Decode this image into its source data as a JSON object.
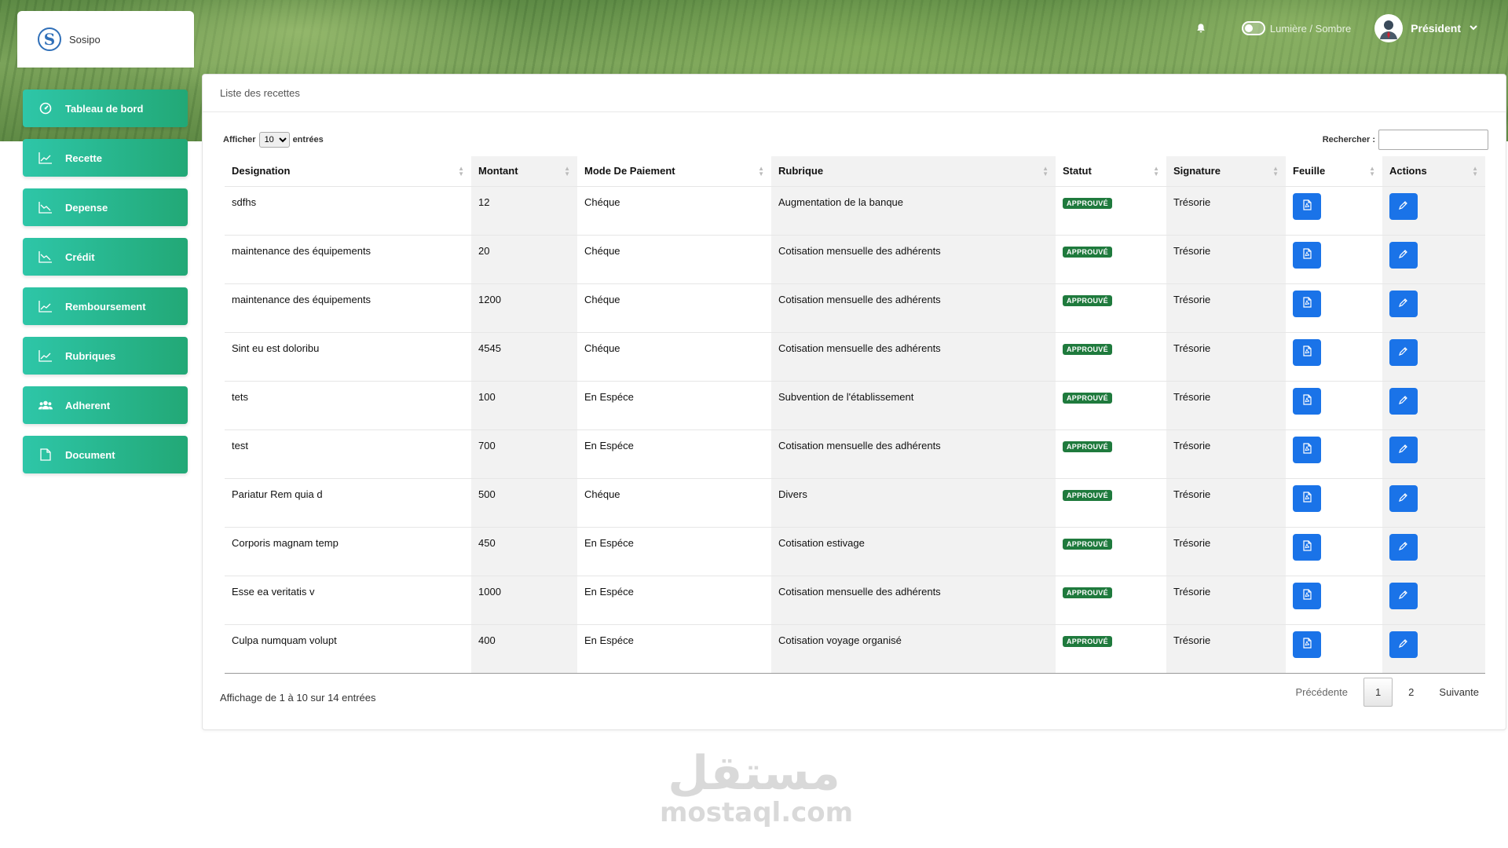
{
  "app": {
    "brand": "Sosipo",
    "logo_letter": "S"
  },
  "topbar": {
    "theme_toggle_label": "Lumière / Sombre",
    "user_name": "Président",
    "icons": [
      "bell-icon",
      "avatar",
      "chevron-down-icon"
    ]
  },
  "sidebar": {
    "items": [
      {
        "label": "Tableau de bord",
        "icon": "dashboard-icon"
      },
      {
        "label": "Recette",
        "icon": "chart-up-icon"
      },
      {
        "label": "Depense",
        "icon": "chart-down-icon"
      },
      {
        "label": "Crédit",
        "icon": "chart-down-icon"
      },
      {
        "label": "Remboursement",
        "icon": "chart-up-icon"
      },
      {
        "label": "Rubriques",
        "icon": "chart-up-icon"
      },
      {
        "label": "Adherent",
        "icon": "users-icon"
      },
      {
        "label": "Document",
        "icon": "document-icon"
      }
    ]
  },
  "card": {
    "title": "Liste des recettes",
    "length_prefix": "Afficher",
    "length_value": "10",
    "length_suffix": "entrées",
    "search_label": "Rechercher :",
    "search_value": ""
  },
  "table": {
    "columns": [
      "Designation",
      "Montant",
      "Mode De Paiement",
      "Rubrique",
      "Statut",
      "Signature",
      "Feuille",
      "Actions"
    ],
    "rows": [
      {
        "designation": "sdfhs",
        "montant": "12",
        "mode": "Chéque",
        "rubrique": "Augmentation de la banque",
        "statut": "APPROUVÉ",
        "signature": "Trésorie"
      },
      {
        "designation": "maintenance des équipements",
        "montant": "20",
        "mode": "Chéque",
        "rubrique": "Cotisation mensuelle des adhérents",
        "statut": "APPROUVÉ",
        "signature": "Trésorie"
      },
      {
        "designation": "maintenance des équipements",
        "montant": "1200",
        "mode": "Chéque",
        "rubrique": "Cotisation mensuelle des adhérents",
        "statut": "APPROUVÉ",
        "signature": "Trésorie"
      },
      {
        "designation": "Sint eu est doloribu",
        "montant": "4545",
        "mode": "Chéque",
        "rubrique": "Cotisation mensuelle des adhérents",
        "statut": "APPROUVÉ",
        "signature": "Trésorie"
      },
      {
        "designation": "tets",
        "montant": "100",
        "mode": "En Espéce",
        "rubrique": "Subvention de l'établissement",
        "statut": "APPROUVÉ",
        "signature": "Trésorie"
      },
      {
        "designation": "test",
        "montant": "700",
        "mode": "En Espéce",
        "rubrique": "Cotisation mensuelle des adhérents",
        "statut": "APPROUVÉ",
        "signature": "Trésorie"
      },
      {
        "designation": "Pariatur Rem quia d",
        "montant": "500",
        "mode": "Chéque",
        "rubrique": "Divers",
        "statut": "APPROUVÉ",
        "signature": "Trésorie"
      },
      {
        "designation": "Corporis magnam temp",
        "montant": "450",
        "mode": "En Espéce",
        "rubrique": "Cotisation estivage",
        "statut": "APPROUVÉ",
        "signature": "Trésorie"
      },
      {
        "designation": "Esse ea veritatis v",
        "montant": "1000",
        "mode": "En Espéce",
        "rubrique": "Cotisation mensuelle des adhérents",
        "statut": "APPROUVÉ",
        "signature": "Trésorie"
      },
      {
        "designation": "Culpa numquam volupt",
        "montant": "400",
        "mode": "En Espéce",
        "rubrique": "Cotisation voyage organisé",
        "statut": "APPROUVÉ",
        "signature": "Trésorie"
      }
    ],
    "row_icons": {
      "feuille": "pdf-file-icon",
      "actions": "edit-pencil-icon"
    }
  },
  "footer": {
    "info": "Affichage de 1 à 10 sur 14 entrées",
    "prev_label": "Précédente",
    "pages": [
      "1",
      "2"
    ],
    "current_page": "1",
    "next_label": "Suivante"
  },
  "watermark": {
    "arabic": "مستقل",
    "latin": "mostaql.com"
  },
  "colors": {
    "accent": "#1a73e8",
    "nav_start": "#2ec6a8",
    "nav_end": "#22a876",
    "badge": "#1f7a3d"
  }
}
